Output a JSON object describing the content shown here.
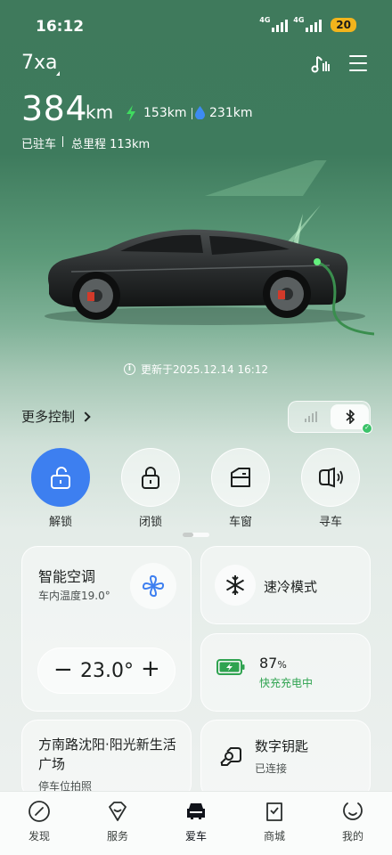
{
  "status_bar": {
    "time": "16:12",
    "net1": "4G",
    "net2": "4G",
    "battery": "20"
  },
  "vehicle": {
    "name": "7xa",
    "range_total": "384",
    "range_unit": "km",
    "electric_range": "153km",
    "fuel_range": "231km",
    "parked": "已驻车",
    "odometer": "总里程 113km"
  },
  "updated": "更新于2025.12.14 16:12",
  "more_control": "更多控制",
  "quick_actions": [
    {
      "label": "解锁",
      "icon": "unlock-icon",
      "active": true
    },
    {
      "label": "闭锁",
      "icon": "lock-icon",
      "active": false
    },
    {
      "label": "车窗",
      "icon": "window-icon",
      "active": false
    },
    {
      "label": "寻车",
      "icon": "horn-icon",
      "active": false
    }
  ],
  "ac": {
    "title": "智能空调",
    "inside_temp": "车内温度19.0°",
    "minus": "−",
    "set_temp": "23.0°",
    "plus": "+"
  },
  "quick_cool": {
    "label": "速冷模式"
  },
  "charge": {
    "percent": "87",
    "unit": "%",
    "status": "快充充电中",
    "level": 0.87
  },
  "location": {
    "title": "方南路沈阳·阳光新生活广场",
    "sub": "停车位拍照"
  },
  "digital_key": {
    "title": "数字钥匙",
    "status": "已连接"
  },
  "nav": [
    {
      "label": "发现",
      "icon": "compass-icon"
    },
    {
      "label": "服务",
      "icon": "service-icon"
    },
    {
      "label": "爱车",
      "icon": "car-icon",
      "active": true
    },
    {
      "label": "商城",
      "icon": "shop-icon"
    },
    {
      "label": "我的",
      "icon": "profile-icon"
    }
  ],
  "colors": {
    "accent_blue": "#3d7ff0",
    "charge_green": "#2fa350",
    "fuel_blue": "#3d8bf2"
  }
}
